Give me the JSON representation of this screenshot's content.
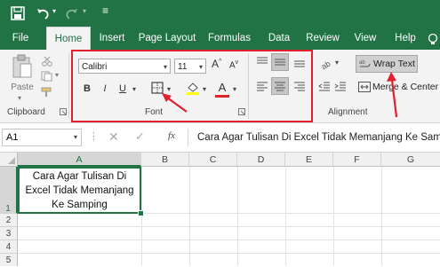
{
  "ribbon_tabs": [
    "File",
    "Home",
    "Insert",
    "Page Layout",
    "Formulas",
    "Data",
    "Review",
    "View",
    "Help"
  ],
  "clipboard": {
    "paste_label": "Paste",
    "group_label": "Clipboard"
  },
  "font": {
    "name": "Calibri",
    "size": "11",
    "grow_label": "A",
    "shrink_label": "A",
    "bold": "B",
    "italic": "I",
    "underline": "U",
    "font_color_label": "A",
    "group_label": "Font"
  },
  "alignment": {
    "wrap_text_label": "Wrap Text",
    "merge_label": "Merge & Center",
    "group_label": "Alignment"
  },
  "formula_bar": {
    "name_box": "A1",
    "fx": "fx",
    "content": "Cara Agar Tulisan Di Excel Tidak Memanjang Ke Samping"
  },
  "columns": [
    "A",
    "B",
    "C",
    "D",
    "E",
    "F",
    "G"
  ],
  "rows": [
    "1",
    "2",
    "3",
    "4",
    "5"
  ],
  "cell_a1": "Cara Agar Tulisan Di Excel Tidak Memanjang Ke Samping",
  "colors": {
    "excel_green": "#217346",
    "highlight_red": "#e0202e",
    "font_color_bar": "#e02424",
    "fill_yellow": "#ffff00"
  }
}
